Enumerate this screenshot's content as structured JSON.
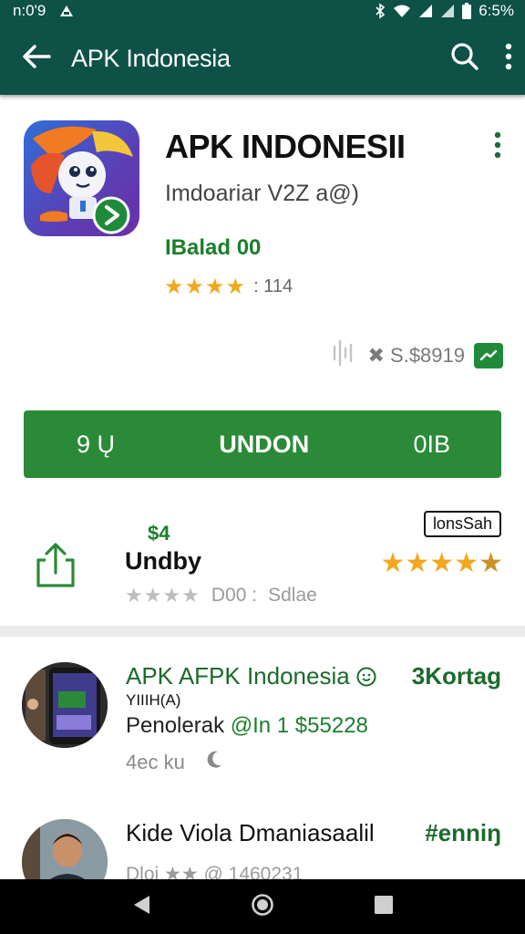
{
  "status_bar": {
    "time": "n:0'9",
    "battery": "6:5%"
  },
  "app_bar": {
    "title": "APK Indonesia"
  },
  "app": {
    "title": "APK INDONESII",
    "subtitle": "Imdoariar V2Z a@)",
    "badge": "IBalad 00",
    "rating_stars": 4,
    "rating_count": ": 114",
    "meta": "✖ S.$8919"
  },
  "install": {
    "left": "9 Ų",
    "center": "UNDON",
    "right": "0IB"
  },
  "developer": {
    "price": "$4",
    "name": "Undby",
    "rating_count": "D00  :",
    "sale": "Sdlae",
    "badge": "lonsSah"
  },
  "list": [
    {
      "title": "APK AFPK Indonesia",
      "tag": "3Kortag",
      "sub": "YIIIH(A)",
      "line_prefix": "Penolerak",
      "line_accent": " @In 1 $55228",
      "meta": "4ec ku"
    },
    {
      "title": "Kide Viola Dmaniasaalil",
      "tag": "#enniŋ",
      "meta": "Dloi ★★ @ 1460231"
    }
  ],
  "colors": {
    "primary": "#0d5147",
    "accent": "#2a8a38",
    "star": "#f2a81d"
  }
}
